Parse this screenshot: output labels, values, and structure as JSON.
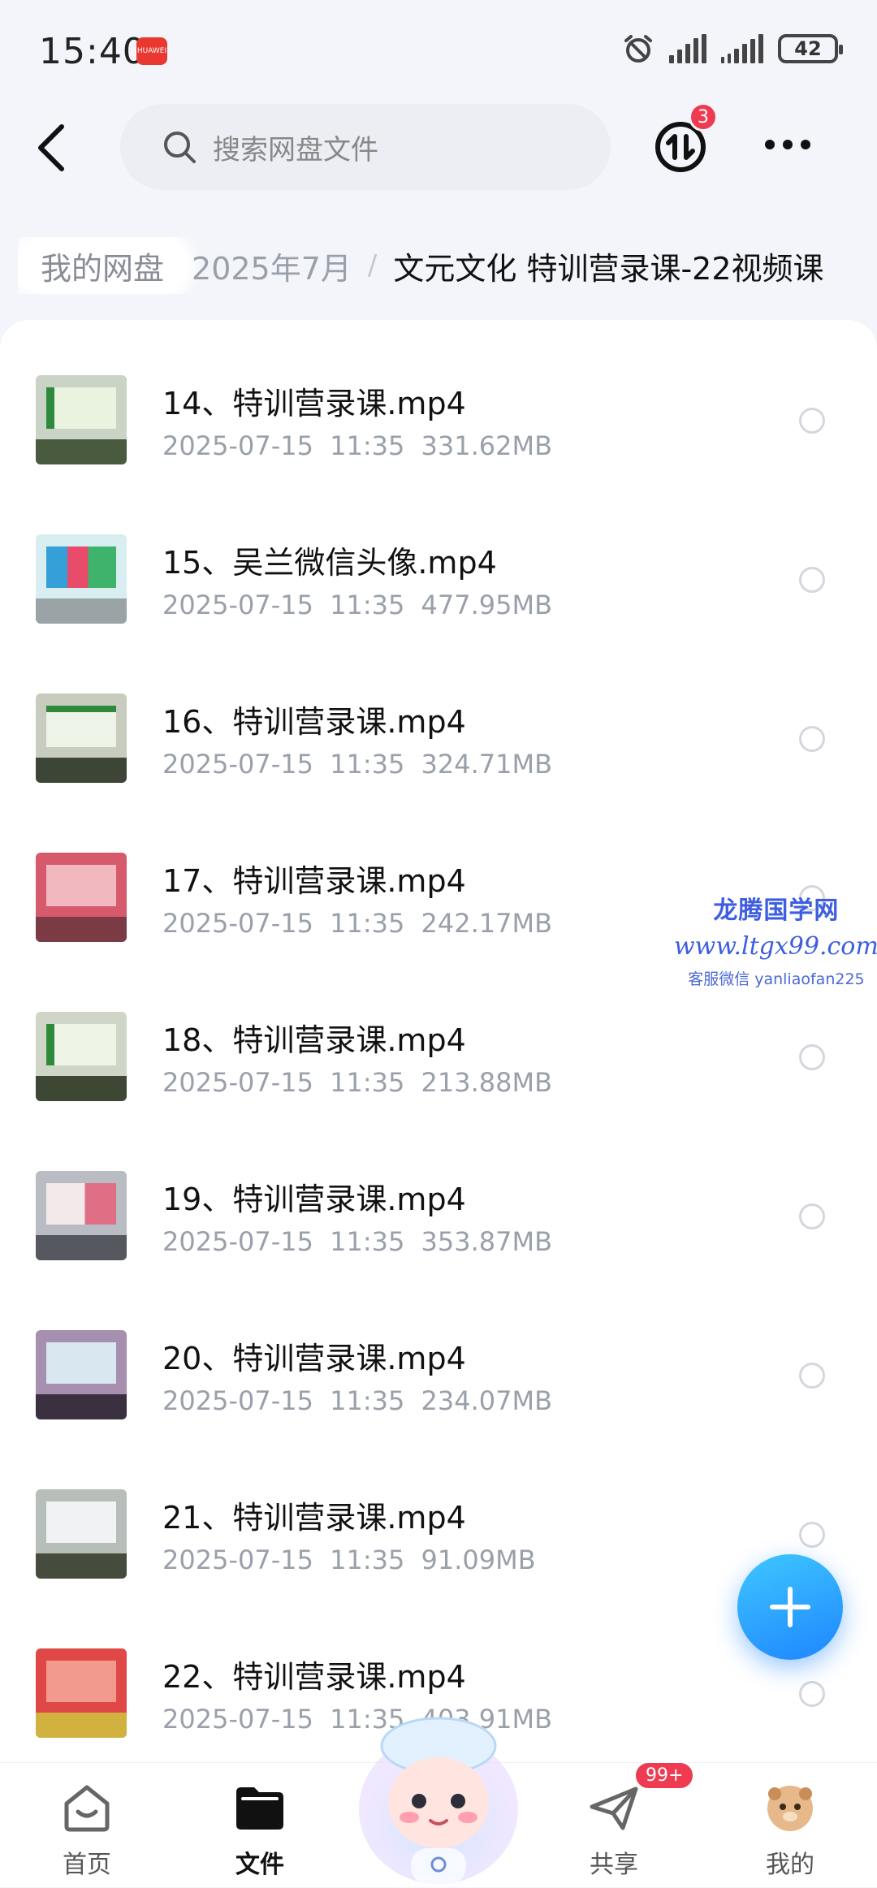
{
  "status_bar": {
    "time": "15:40",
    "app_badge": "HUAWEI",
    "battery": "42"
  },
  "header": {
    "search_placeholder": "搜索网盘文件",
    "transfer_badge": "3"
  },
  "breadcrumb": {
    "root": "我的网盘",
    "middle": "2025年7月",
    "separator": "/",
    "current": "文元文化 特训营录课-22视频课"
  },
  "files": [
    {
      "name": "14、特训营录课.mp4",
      "date": "2025-07-15",
      "time": "11:35",
      "size": "331.62MB"
    },
    {
      "name": "15、吴兰微信头像.mp4",
      "date": "2025-07-15",
      "time": "11:35",
      "size": "477.95MB"
    },
    {
      "name": "16、特训营录课.mp4",
      "date": "2025-07-15",
      "time": "11:35",
      "size": "324.71MB"
    },
    {
      "name": "17、特训营录课.mp4",
      "date": "2025-07-15",
      "time": "11:35",
      "size": "242.17MB"
    },
    {
      "name": "18、特训营录课.mp4",
      "date": "2025-07-15",
      "time": "11:35",
      "size": "213.88MB"
    },
    {
      "name": "19、特训营录课.mp4",
      "date": "2025-07-15",
      "time": "11:35",
      "size": "353.87MB"
    },
    {
      "name": "20、特训营录课.mp4",
      "date": "2025-07-15",
      "time": "11:35",
      "size": "234.07MB"
    },
    {
      "name": "21、特训营录课.mp4",
      "date": "2025-07-15",
      "time": "11:35",
      "size": "91.09MB"
    },
    {
      "name": "22、特训营录课.mp4",
      "date": "2025-07-15",
      "time": "11:35",
      "size": "403.91MB"
    }
  ],
  "watermark": {
    "line1": "龙腾国学网",
    "line2": "www.ltgx99.com",
    "line3": "客服微信 yanliaofan225"
  },
  "nav": {
    "home": "首页",
    "files": "文件",
    "share": "共享",
    "share_badge": "99+",
    "me": "我的"
  },
  "colors": {
    "accent": "#1e86ff",
    "badge": "#ef3b52",
    "watermark": "#3d5ee0"
  }
}
